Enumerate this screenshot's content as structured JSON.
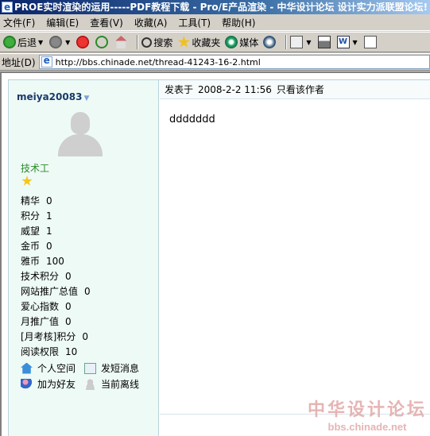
{
  "window": {
    "title": "PROE实时渲染的运用-----PDF教程下载 - Pro/E产品渲染 - 中华设计论坛 设计实力派联盟论坛!"
  },
  "menu": [
    "文件(F)",
    "编辑(E)",
    "查看(V)",
    "收藏(A)",
    "工具(T)",
    "帮助(H)"
  ],
  "toolbar": {
    "back": "后退",
    "search": "搜索",
    "favorites": "收藏夹",
    "media": "媒体"
  },
  "address": {
    "label": "地址(D)",
    "url": "http://bbs.chinade.net/thread-41243-16-2.html"
  },
  "post": {
    "username": "meiya20083",
    "rank": "技术工",
    "stats": [
      {
        "label": "精华",
        "value": "0"
      },
      {
        "label": "积分",
        "value": "1"
      },
      {
        "label": "威望",
        "value": "1"
      },
      {
        "label": "金币",
        "value": "0"
      },
      {
        "label": "雅币",
        "value": "100"
      },
      {
        "label": "技术积分",
        "value": "0"
      },
      {
        "label": "网站推广总值",
        "value": "0"
      },
      {
        "label": "爱心指数",
        "value": "0"
      },
      {
        "label": "月推广值",
        "value": "0"
      },
      {
        "label": "[月考核]积分",
        "value": "0"
      },
      {
        "label": "阅读权限",
        "value": "10"
      }
    ],
    "actions": {
      "space": "个人空间",
      "message": "发短消息",
      "add_friend": "加为好友",
      "status": "当前离线"
    },
    "header": {
      "posted_label": "发表于",
      "time": "2008-2-2 11:56",
      "author_only": "只看该作者"
    },
    "body": "ddddddd"
  },
  "watermark": {
    "line1": "中华设计论坛",
    "line2": "bbs.chinade.net"
  }
}
